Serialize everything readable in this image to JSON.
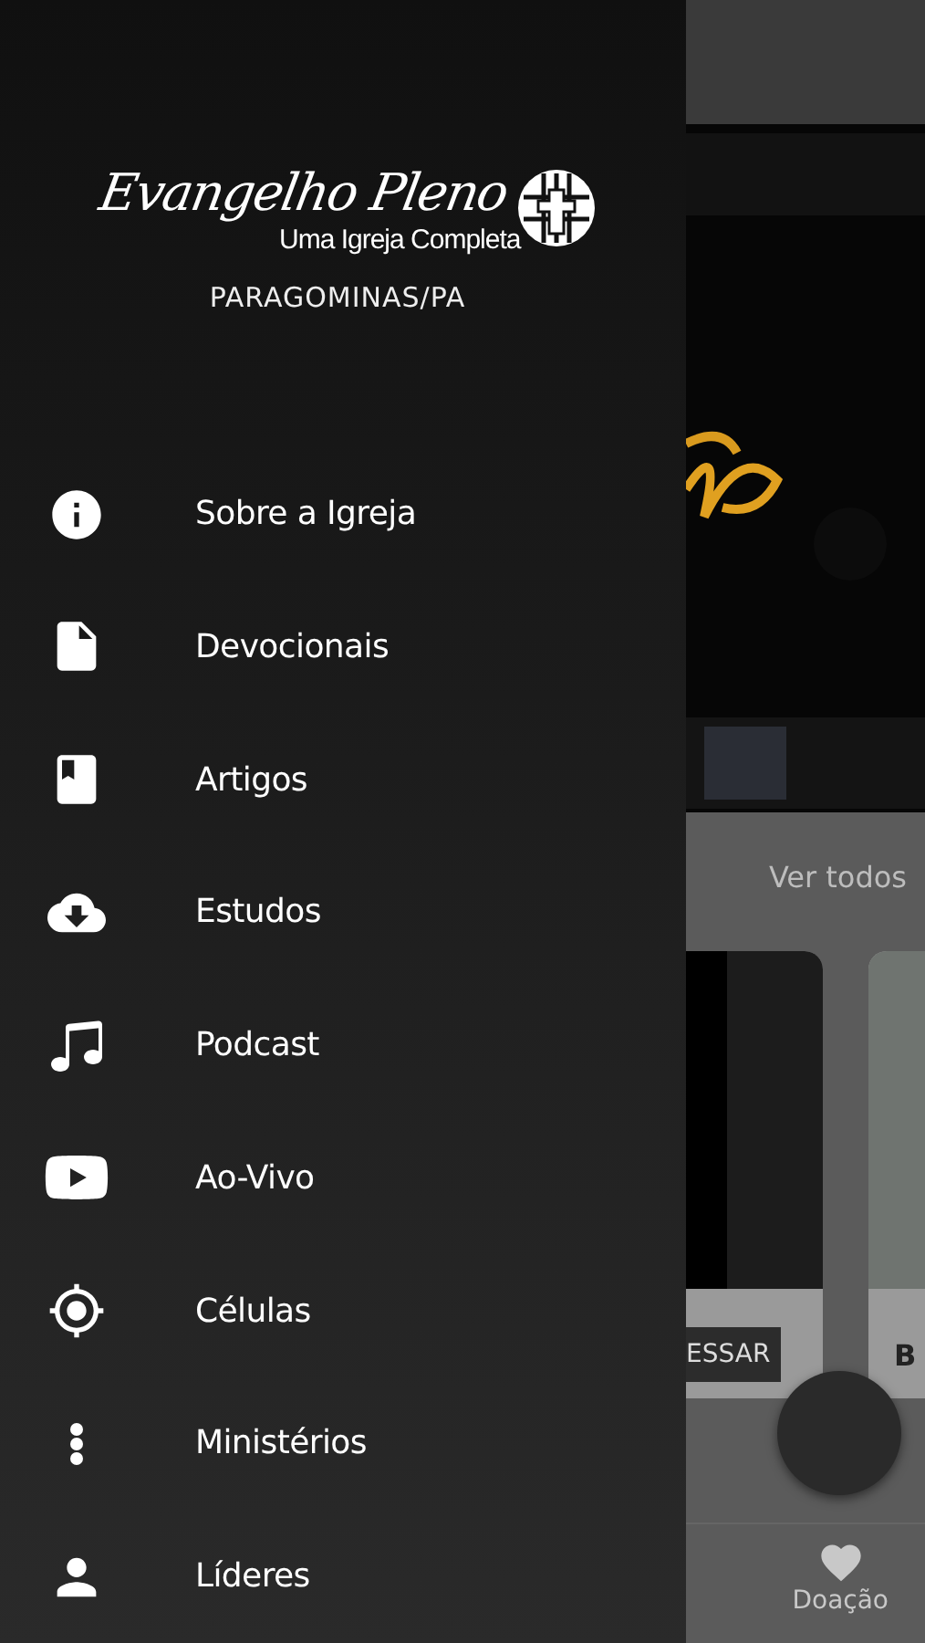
{
  "drawer": {
    "logo": {
      "script": "Evangelho Pleno",
      "tagline": "Uma Igreja Completa"
    },
    "location": "PARAGOMINAS/PA",
    "items": [
      {
        "kind": "info",
        "label": "Sobre a Igreja"
      },
      {
        "kind": "file",
        "label": "Devocionais"
      },
      {
        "kind": "book",
        "label": "Artigos"
      },
      {
        "kind": "cloud-download",
        "label": "Estudos"
      },
      {
        "kind": "music",
        "label": "Podcast"
      },
      {
        "kind": "video",
        "label": "Ao-Vivo"
      },
      {
        "kind": "target",
        "label": "Células"
      },
      {
        "kind": "more",
        "label": "Ministérios"
      },
      {
        "kind": "person",
        "label": "Líderes"
      }
    ]
  },
  "background": {
    "section_link": "Ver todos",
    "cards": [
      {
        "button": "ESSAR"
      },
      {
        "title": "B"
      }
    ],
    "bottom_nav": [
      {
        "kind": "heart",
        "label": "Doação"
      }
    ]
  }
}
